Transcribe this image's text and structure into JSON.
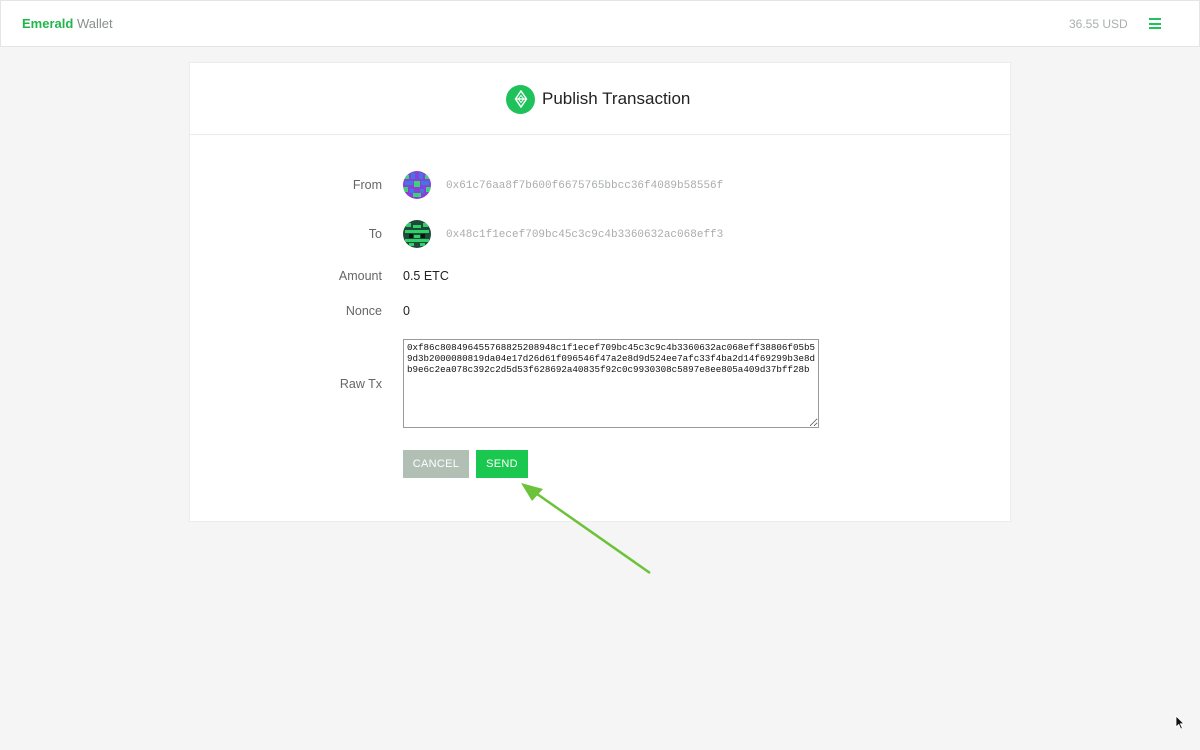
{
  "app": {
    "brand_primary": "Emerald",
    "brand_secondary": "Wallet"
  },
  "header": {
    "balance": "36.55 USD"
  },
  "page": {
    "title": "Publish Transaction"
  },
  "form": {
    "from": {
      "label": "From",
      "address": "0x61c76aa8f7b600f6675765bbcc36f4089b58556f"
    },
    "to": {
      "label": "To",
      "address": "0x48c1f1ecef709bc45c3c9c4b3360632ac068eff3"
    },
    "amount": {
      "label": "Amount",
      "value": "0.5 ETC"
    },
    "nonce": {
      "label": "Nonce",
      "value": "0"
    },
    "raw_tx": {
      "label": "Raw Tx",
      "value": "0xf86c808496455768825208948c1f1ecef709bc45c3c9c4b3360632ac068eff38806f05b59d3b2000080819da04e17d26d61f096546f47a2e8d9d524ee7afc33f4ba2d14f69299b3e8db9e6c2ea078c392c2d5d53f628692a40835f92c0c9930308c5897e8ee805a409d37bff28b"
    }
  },
  "actions": {
    "cancel_label": "CANCEL",
    "send_label": "SEND"
  },
  "colors": {
    "accent": "#1ac84f",
    "cancel": "#b2bfb4",
    "annotation_arrow": "#6cc33a"
  },
  "icons": {
    "menu": "hamburger-icon",
    "currency": "ethereum-classic-icon",
    "pointer": "mouse-cursor-icon"
  }
}
